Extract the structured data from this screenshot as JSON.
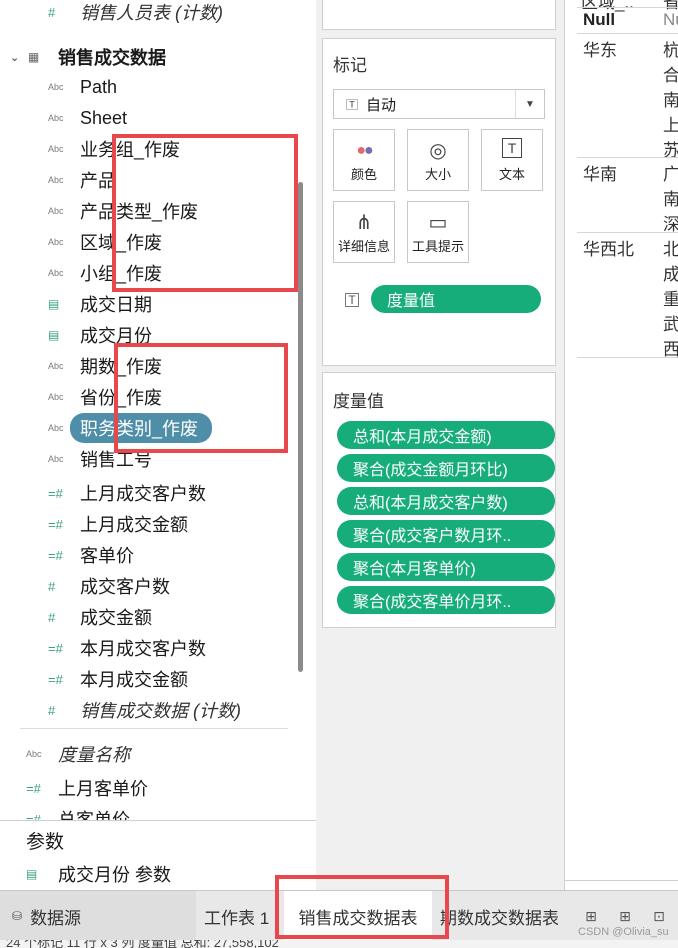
{
  "data_pane": {
    "top_partial_field": {
      "icon": "hash-icon",
      "label": "销售人员表 (计数)"
    },
    "table": {
      "label": "销售成交数据",
      "icon": "table-icon"
    },
    "fields": [
      {
        "icon": "abc-icon",
        "label": "Path"
      },
      {
        "icon": "abc-icon",
        "label": "Sheet"
      },
      {
        "icon": "abc-icon",
        "label": "业务组_作废"
      },
      {
        "icon": "abc-icon",
        "label": "产品"
      },
      {
        "icon": "abc-icon",
        "label": "产品类型_作废"
      },
      {
        "icon": "abc-icon",
        "label": "区域_作废"
      },
      {
        "icon": "abc-icon",
        "label": "小组_作废"
      },
      {
        "icon": "calendar-icon",
        "label": "成交日期"
      },
      {
        "icon": "calendar-calc-icon",
        "label": "成交月份"
      },
      {
        "icon": "abc-icon",
        "label": "期数_作废"
      },
      {
        "icon": "abc-icon",
        "label": "省份_作废"
      },
      {
        "icon": "abc-icon",
        "label": "职务类别_作废",
        "selected": true
      },
      {
        "icon": "abc-icon",
        "label": "销售工号"
      },
      {
        "icon": "hash-calc-icon",
        "label": "上月成交客户数"
      },
      {
        "icon": "hash-calc-icon",
        "label": "上月成交金额"
      },
      {
        "icon": "hash-calc-icon",
        "label": "客单价"
      },
      {
        "icon": "hash-icon",
        "label": "成交客户数"
      },
      {
        "icon": "hash-icon",
        "label": "成交金额"
      },
      {
        "icon": "hash-calc-icon",
        "label": "本月成交客户数"
      },
      {
        "icon": "hash-calc-icon",
        "label": "本月成交金额"
      },
      {
        "icon": "hash-icon",
        "label": "销售成交数据 (计数)",
        "italic": true
      }
    ],
    "measure_names": {
      "icon": "abc-icon",
      "label": "度量名称"
    },
    "extra_fields": [
      {
        "icon": "hash-calc-icon",
        "label": "上月客单价"
      },
      {
        "icon": "hash-calc-icon",
        "label": "总客单价"
      }
    ],
    "parameters_header": "参数",
    "parameters": [
      {
        "icon": "calendar-calc-icon",
        "label": "成交月份 参数"
      }
    ]
  },
  "marks_card": {
    "title": "标记",
    "mark_type": "自动",
    "buttons": [
      {
        "name": "color",
        "label": "颜色"
      },
      {
        "name": "size",
        "label": "大小"
      },
      {
        "name": "text",
        "label": "文本"
      },
      {
        "name": "detail",
        "label": "详细信息"
      },
      {
        "name": "tooltip",
        "label": "工具提示"
      }
    ],
    "text_pill": "度量值"
  },
  "measure_values_card": {
    "title": "度量值",
    "pills": [
      "总和(本月成交金额)",
      "聚合(成交金额月环比)",
      "总和(本月成交客户数)",
      "聚合(成交客户数月环..",
      "聚合(本月客单价)",
      "聚合(成交客单价月环.."
    ]
  },
  "view": {
    "header_partial": [
      "区域_..",
      "省"
    ],
    "rows": [
      {
        "region": "Null",
        "province": "Nu"
      },
      {
        "region": "华东",
        "provinces": [
          "杭",
          "合",
          "南",
          "上",
          "苏"
        ]
      },
      {
        "region": "华南",
        "provinces": [
          "广",
          "南",
          "深"
        ]
      },
      {
        "region": "华西北",
        "provinces": [
          "北",
          "成",
          "重",
          "武",
          "西"
        ]
      }
    ]
  },
  "tabs": {
    "datasource": "数据源",
    "sheets": [
      "工作表 1",
      "销售成交数据表",
      "期数成交数据表"
    ],
    "active": "销售成交数据表"
  },
  "status": {
    "text": "24 个标记   11 行 x 3 列   度量值 总和: 27,558,102",
    "watermark": "CSDN @Olivia_su"
  },
  "colors": {
    "accent_pill": "#16ad7a",
    "selected_field": "#4f8ea8",
    "highlight_box": "#e8474b"
  }
}
